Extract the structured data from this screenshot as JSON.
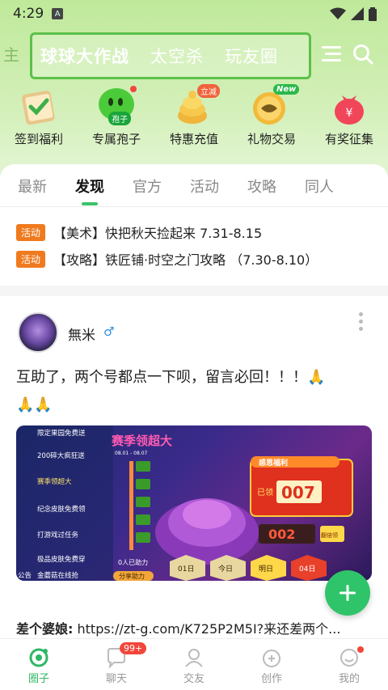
{
  "status_bar": {
    "time": "4:29",
    "notif": "A"
  },
  "header": {
    "left_cut": "主",
    "tabs": [
      "球球大作战",
      "太空杀",
      "玩友圈"
    ]
  },
  "shortcuts": [
    {
      "label": "签到福利",
      "icon": "checkin-icon"
    },
    {
      "label": "专属孢子",
      "icon": "spore-icon",
      "tag": "孢子"
    },
    {
      "label": "特惠充值",
      "icon": "recharge-icon",
      "tag": "立减"
    },
    {
      "label": "礼物交易",
      "icon": "gift-trade-icon",
      "tag": "New"
    },
    {
      "label": "有奖征集",
      "icon": "prize-icon"
    }
  ],
  "content_tabs": [
    "最新",
    "发现",
    "官方",
    "活动",
    "攻略",
    "同人"
  ],
  "announcements": [
    {
      "tag": "活动",
      "text": "【美术】快把秋天捡起来 7.31-8.15"
    },
    {
      "tag": "活动",
      "text": "【攻略】铁匠铺·时空之门攻略 （7.30-8.10）"
    }
  ],
  "post": {
    "username": "無米",
    "gender_symbol": "♂",
    "text": "互助了，两个号都点一下呗，留言必回！！！🙏",
    "text2": "🙏🙏",
    "image": {
      "title": "赛季领超大",
      "dates": "08.01 - 08.07",
      "banner": "感恩福利",
      "already": "已领",
      "count1": "007",
      "count2": "002",
      "claim": "翻倍领",
      "help_count": "0人已助力",
      "share": "分享助力",
      "days": [
        "01日",
        "今日",
        "明日",
        "04日"
      ],
      "menu": [
        "限定果园免费送",
        "200碎大疯狂送",
        "赛季领超大",
        "纪念皮肤免费领",
        "打游戏过任务",
        "极品皮肤免费穿",
        "金蘑菇在线抢",
        "公告"
      ]
    },
    "comment_user": "差个婆娘:",
    "comment_text": "https://zt-g.com/K725P2M5I?来还差两个..."
  },
  "bottom_nav": [
    {
      "label": "圈子",
      "icon": "circle-icon",
      "active": true
    },
    {
      "label": "聊天",
      "icon": "chat-icon",
      "badge": "99+"
    },
    {
      "label": "交友",
      "icon": "friends-icon"
    },
    {
      "label": "创作",
      "icon": "create-icon"
    },
    {
      "label": "我的",
      "icon": "profile-icon",
      "dot": true
    }
  ],
  "colors": {
    "accent": "#2fc46a",
    "tag": "#f07a1e",
    "header_border": "#5cc04a"
  }
}
